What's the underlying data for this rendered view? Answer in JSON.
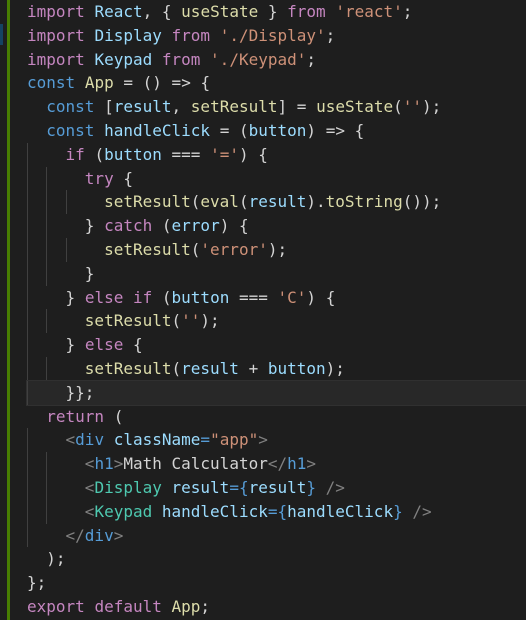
{
  "editor": {
    "colors": {
      "background": "#1e1e1e",
      "keyword_control": "#c586c0",
      "keyword_storage": "#569cd6",
      "function": "#dcdcaa",
      "string": "#ce9178",
      "variable": "#9cdcfe",
      "component": "#4ec9b0",
      "punctuation": "#d4d4d4",
      "git_added": "#487e02"
    },
    "lines": [
      "import React, { useState } from 'react';",
      "import Display from './Display';",
      "import Keypad from './Keypad';",
      "const App = () => {",
      "  const [result, setResult] = useState('');",
      "  const handleClick = (button) => {",
      "    if (button === '=') {",
      "      try {",
      "        setResult(eval(result).toString());",
      "      } catch (error) {",
      "        setResult('error');",
      "      }",
      "    } else if (button === 'C') {",
      "      setResult('');",
      "    } else {",
      "      setResult(result + button);",
      "    }};",
      "  return (",
      "    <div className=\"app\">",
      "      <h1>Math Calculator</h1>",
      "      <Display result={result} />",
      "      <Keypad handleClick={handleClick} />",
      "    </div>",
      "  );",
      "};",
      "export default App;"
    ]
  }
}
